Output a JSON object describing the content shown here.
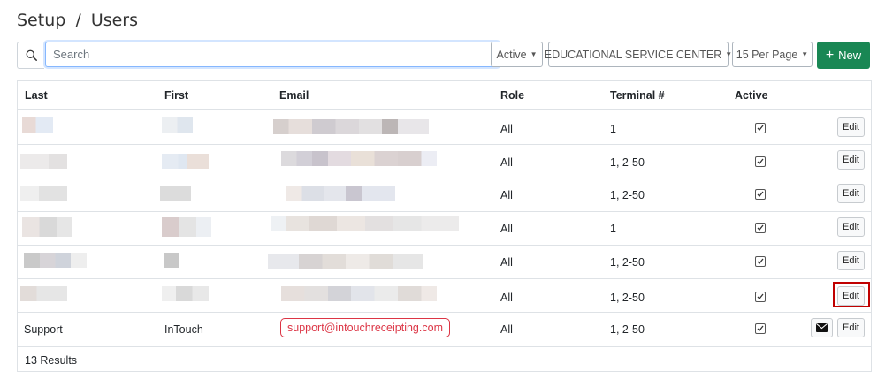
{
  "breadcrumb": {
    "root": "Setup",
    "separator": "/",
    "current": "Users"
  },
  "toolbar": {
    "search_placeholder": "Search",
    "search_value": "",
    "status_filter": "Active",
    "location_filter": "EDUCATIONAL SERVICE CENTER",
    "per_page": "15 Per Page",
    "new_label": "New"
  },
  "table": {
    "headers": {
      "last": "Last",
      "first": "First",
      "email": "Email",
      "role": "Role",
      "terminal": "Terminal #",
      "active": "Active"
    },
    "rows": [
      {
        "last": "",
        "first": "",
        "email": "",
        "role": "All",
        "terminal": "1",
        "active": true,
        "edit": "Edit"
      },
      {
        "last": "",
        "first": "",
        "email": "",
        "role": "All",
        "terminal": "1, 2-50",
        "active": true,
        "edit": "Edit"
      },
      {
        "last": "",
        "first": "",
        "email": "",
        "role": "All",
        "terminal": "1, 2-50",
        "active": true,
        "edit": "Edit"
      },
      {
        "last": "",
        "first": "",
        "email": "",
        "role": "All",
        "terminal": "1",
        "active": true,
        "edit": "Edit"
      },
      {
        "last": "",
        "first": "",
        "email": "",
        "role": "All",
        "terminal": "1, 2-50",
        "active": true,
        "edit": "Edit"
      },
      {
        "last": "",
        "first": "",
        "email": "",
        "role": "All",
        "terminal": "1, 2-50",
        "active": true,
        "edit": "Edit",
        "highlighted": true
      },
      {
        "last": "Support",
        "first": "InTouch",
        "email": "support@intouchreceipting.com",
        "role": "All",
        "terminal": "1, 2-50",
        "active": true,
        "edit": "Edit",
        "has_mail_button": true
      }
    ]
  },
  "footer": {
    "results": "13 Results"
  },
  "colors": {
    "new_button": "#198754",
    "highlight": "#c00000",
    "email_accent": "#dc3545",
    "focus_border": "#86b7fe"
  }
}
